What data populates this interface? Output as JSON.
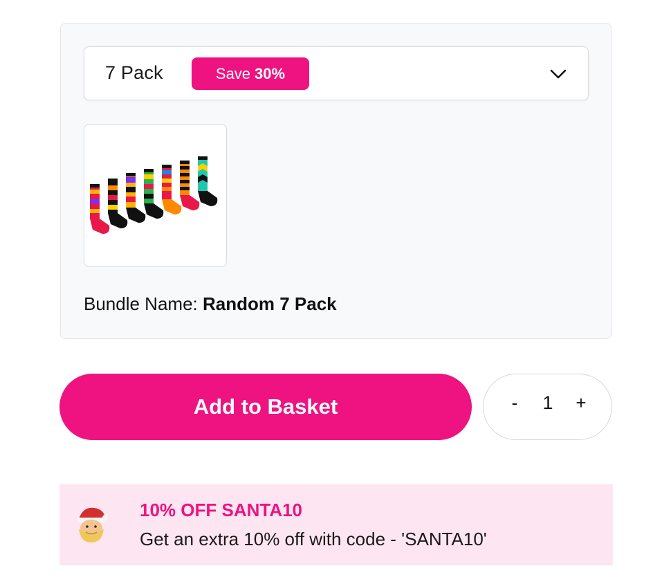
{
  "bundle": {
    "selected_option": "7 Pack",
    "badge_prefix": "Save",
    "badge_value": "30%",
    "name_label": "Bundle Name:",
    "name_value": "Random 7 Pack",
    "thumbnail_icon": "colorful-socks-image"
  },
  "actions": {
    "add_to_basket_label": "Add to Basket",
    "quantity": "1",
    "decrement_label": "-",
    "increment_label": "+"
  },
  "promo": {
    "icon": "santa-emoji",
    "title": "10% OFF SANTA10",
    "text": "Get an extra 10% off with code - 'SANTA10'"
  },
  "colors": {
    "accent": "#ee1380",
    "promo_background": "#fde6f1",
    "card_background": "#f8f9fb"
  }
}
